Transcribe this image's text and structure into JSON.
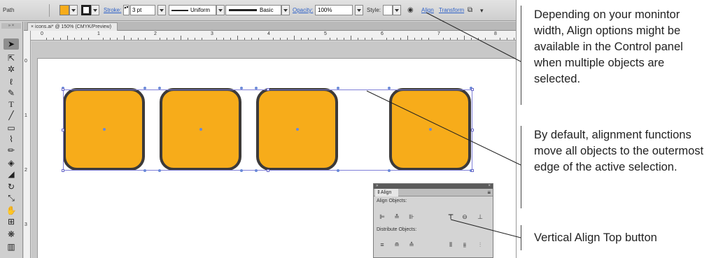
{
  "control_bar": {
    "object_type": "Path",
    "stroke_label": "Stroke:",
    "stroke_value": "3 pt",
    "profile_label": "Uniform",
    "brush_label": "Basic",
    "opacity_label": "Opacity:",
    "opacity_value": "100%",
    "style_label": "Style:",
    "align_link": "Align",
    "transform_link": "Transform"
  },
  "document": {
    "tab_title": "icons.ai* @ 150% (CMYK/Preview)",
    "ruler_top": [
      "0",
      "1",
      "2",
      "3",
      "4",
      "5",
      "6",
      "7",
      "8"
    ],
    "ruler_left": [
      "0",
      "1",
      "2",
      "3"
    ]
  },
  "align_panel": {
    "tab_label": "Align",
    "align_objects_label": "Align Objects:",
    "distribute_objects_label": "Distribute Objects:"
  },
  "annotations": [
    {
      "text": "Depending on your monintor width, Align options might be available in the Control panel when multiple objects are selected."
    },
    {
      "text": "By default, alignment functions move all objects to the outermost edge of the active selection."
    },
    {
      "text": "Vertical Align Top button"
    }
  ],
  "colors": {
    "shape_fill": "#f7ac1a",
    "shape_stroke": "#3c3a3a",
    "selection": "#7f7fd8"
  },
  "icons": {
    "tools": [
      "selection-tool-icon",
      "direct-selection-tool-icon",
      "magic-wand-icon",
      "lasso-icon",
      "pen-tool-icon",
      "type-tool-icon",
      "line-tool-icon",
      "rectangle-tool-icon",
      "paintbrush-icon",
      "pencil-icon",
      "blob-brush-icon",
      "eraser-icon",
      "rotate-tool-icon",
      "scale-tool-icon",
      "warp-tool-icon",
      "free-transform-icon",
      "symbol-sprayer-icon",
      "graph-tool-icon"
    ],
    "align_buttons": [
      "horizontal-align-left-icon",
      "horizontal-align-center-icon",
      "horizontal-align-right-icon",
      "vertical-align-top-icon",
      "vertical-align-center-icon",
      "vertical-align-bottom-icon"
    ],
    "distribute_buttons": [
      "vertical-distribute-top-icon",
      "vertical-distribute-center-icon",
      "vertical-distribute-bottom-icon",
      "horizontal-distribute-left-icon",
      "horizontal-distribute-center-icon",
      "horizontal-distribute-right-icon"
    ]
  }
}
